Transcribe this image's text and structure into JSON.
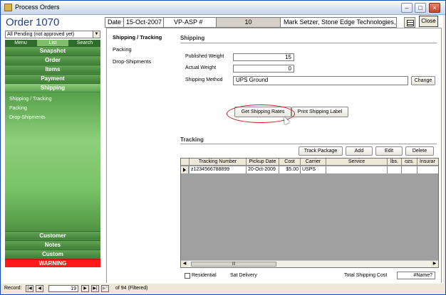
{
  "window": {
    "title": "Process Orders"
  },
  "order": {
    "title": "Order",
    "number": "1070"
  },
  "header_bar": {
    "date_label": "Date",
    "date_value": "15-Oct-2007",
    "source": "VP-ASP #",
    "source_num": "10",
    "customer": "Mark Setzer, Stone Edge Technologies,"
  },
  "close_label": "Close",
  "filter": {
    "value": "All Pending (not approved yet)"
  },
  "side_tabs": [
    "Menu",
    "List",
    "Search"
  ],
  "nav": {
    "top": [
      "Snapshot",
      "Order",
      "Items",
      "Payment",
      "Shipping"
    ],
    "sub": [
      "Shipping / Tracking",
      "Packing",
      "Drop-Shipments"
    ],
    "bottom": [
      "Customer",
      "Notes",
      "Custom",
      "WARNING"
    ]
  },
  "midnav": [
    "Shipping / Tracking",
    "Packing",
    "Drop-Shipments"
  ],
  "shipping": {
    "heading": "Shipping",
    "published_weight_label": "Published Weight",
    "published_weight": "15",
    "actual_weight_label": "Actual Weight",
    "actual_weight": "0",
    "method_label": "Shipping Method",
    "method_value": "UPS Ground",
    "change_label": "Change",
    "get_rates_label": "Get Shipping Rates",
    "print_label": "Print Shipping Label"
  },
  "tracking": {
    "heading": "Tracking",
    "buttons": [
      "Track Package",
      "Add",
      "Edit",
      "Delete"
    ],
    "columns": [
      "Tracking Number",
      "Pickup Date",
      "Cost",
      "Carrier",
      "Service",
      "lbs.",
      "ozs.",
      "Insurar"
    ],
    "rows": [
      [
        "z1234566788899",
        "20-Oct-2009",
        "$5.00",
        "USPS",
        "",
        "",
        "",
        ""
      ]
    ]
  },
  "footer": {
    "residential_label": "Residential",
    "sat_delivery_label": "Sat Delivery",
    "total_cost_label": "Total Shipping Cost",
    "total_cost_value": "#Name?"
  },
  "status": {
    "record_label": "Record:",
    "current": "19",
    "of_label": "of  94 (Filtered)"
  },
  "colors": {
    "accent_blue": "#1f3f8f",
    "nav_green": "#4c8c42",
    "warning_red": "#ff1a1a",
    "callout_red": "#d01818"
  },
  "icons": [
    "app-icon",
    "minimize-icon",
    "maximize-icon",
    "close-icon",
    "report-icon",
    "dropdown-arrow-icon",
    "scroll-left-icon",
    "scroll-right-icon",
    "record-selector-icon",
    "cursor-icon"
  ]
}
